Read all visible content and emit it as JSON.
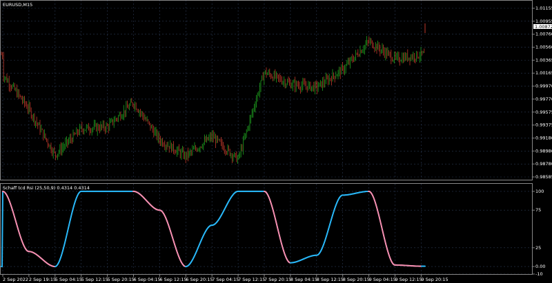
{
  "window": {
    "symbol_title": "EURUSD,M15",
    "indicator_title": "Schaff tcd Rsi (25,50,9) 0.4314 0.4314"
  },
  "price_panel": {
    "y_ticks": [
      "1.01155",
      "1.00955",
      "1.00760",
      "1.00560",
      "1.00365",
      "1.00165",
      "0.99970",
      "0.99770",
      "0.99575",
      "0.99375",
      "0.99180",
      "0.98980",
      "0.98780",
      "0.98585"
    ],
    "current_price": "1.00872"
  },
  "indicator_panel": {
    "y_ticks": [
      "100",
      "75",
      "25",
      "0.00",
      "-10"
    ]
  },
  "x_axis": {
    "labels": [
      "2 Sep 2022",
      "2 Sep 19:15",
      "5 Sep 04:15",
      "5 Sep 12:15",
      "5 Sep 20:15",
      "6 Sep 04:15",
      "6 Sep 12:15",
      "6 Sep 20:15",
      "7 Sep 04:15",
      "7 Sep 12:15",
      "7 Sep 20:15",
      "8 Sep 04:15",
      "8 Sep 12:15",
      "8 Sep 20:15",
      "9 Sep 04:15",
      "9 Sep 12:15",
      "9 Sep 20:15"
    ]
  },
  "colors": {
    "background": "#000000",
    "grid": "#2b3a55",
    "bull_candle": "#1fa21f",
    "bear_candle": "#c0392b",
    "stc_up": "#29b6f6",
    "stc_down": "#f48fb1",
    "text": "#ffffff",
    "current_price_bg": "#ffffff"
  },
  "chart_data": [
    {
      "type": "line",
      "name": "EURUSD M15 price (approximate close)",
      "x": [
        "2 Sep 2022",
        "2 Sep 19:15",
        "5 Sep 04:15",
        "5 Sep 12:15",
        "5 Sep 20:15",
        "6 Sep 04:15",
        "6 Sep 12:15",
        "6 Sep 20:15",
        "7 Sep 04:15",
        "7 Sep 12:15",
        "7 Sep 20:15",
        "8 Sep 04:15",
        "8 Sep 12:15",
        "8 Sep 20:15",
        "9 Sep 04:15",
        "9 Sep 12:15",
        "9 Sep 20:15"
      ],
      "values": [
        1.0015,
        0.9962,
        0.9892,
        0.9932,
        0.9935,
        0.9972,
        0.9915,
        0.989,
        0.992,
        0.9885,
        1.0018,
        1.0,
        0.9995,
        1.0022,
        1.0065,
        1.0038,
        1.0045
      ],
      "ylim": [
        0.98585,
        1.01155
      ],
      "grid": true
    },
    {
      "type": "line",
      "name": "Schaff tcd Rsi (25,50,9)",
      "x": [
        "2 Sep 2022",
        "2 Sep 19:15",
        "5 Sep 04:15",
        "5 Sep 12:15",
        "5 Sep 20:15",
        "6 Sep 04:15",
        "6 Sep 12:15",
        "6 Sep 20:15",
        "7 Sep 04:15",
        "7 Sep 12:15",
        "7 Sep 20:15",
        "8 Sep 04:15",
        "8 Sep 12:15",
        "8 Sep 20:15",
        "9 Sep 04:15",
        "9 Sep 12:15",
        "9 Sep 20:15"
      ],
      "values": [
        100,
        20,
        0,
        100,
        100,
        100,
        75,
        0,
        55,
        100,
        100,
        5,
        15,
        95,
        100,
        2,
        0.4314
      ],
      "ylim": [
        -10,
        110
      ],
      "y_ticks": [
        100,
        75,
        25,
        0,
        -10
      ]
    }
  ]
}
